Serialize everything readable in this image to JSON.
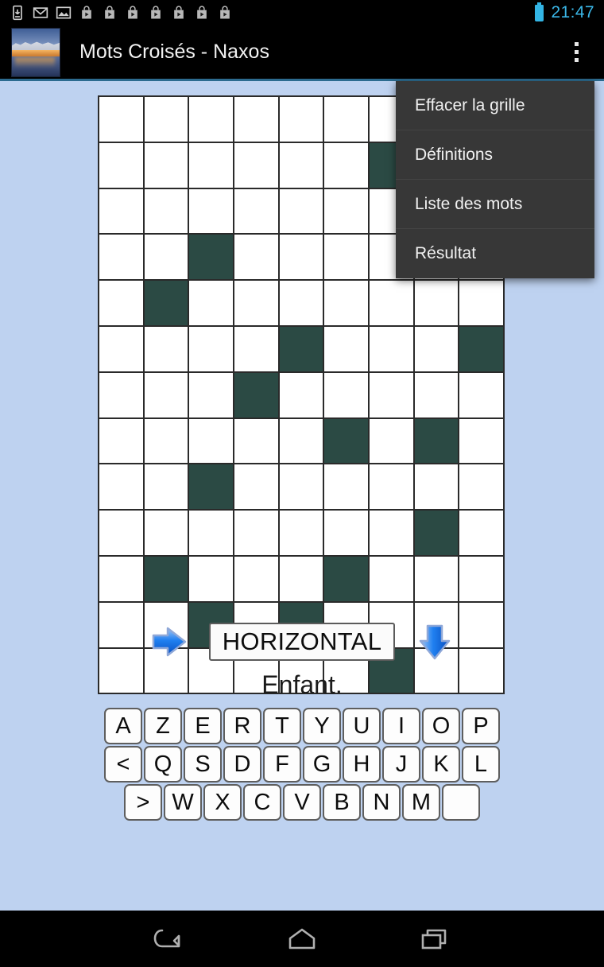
{
  "status_bar": {
    "clock": "21:47",
    "battery_icon": "battery-icon",
    "icons": [
      "download-icon",
      "gmail-icon",
      "screenshot-icon",
      "play-store-icon",
      "play-store-icon",
      "play-store-icon",
      "play-store-icon",
      "play-store-icon",
      "play-store-icon",
      "play-store-icon"
    ]
  },
  "action_bar": {
    "title": "Mots Croisés - Naxos",
    "app_icon": "naxos-photo-icon",
    "overflow_icon": "overflow-menu-icon"
  },
  "overflow_menu": {
    "items": [
      {
        "label": "Effacer la grille"
      },
      {
        "label": "Définitions"
      },
      {
        "label": "Liste des mots"
      },
      {
        "label": "Résultat"
      }
    ]
  },
  "grid": {
    "columns": 9,
    "rows": 13,
    "blocked_color": "#2b4a44",
    "cell_color": "#ffffff",
    "line_color": "#2a2a2a",
    "cells": [
      [
        "",
        "",
        "",
        "",
        "",
        "",
        "",
        "",
        ""
      ],
      [
        "",
        "",
        "",
        "",
        "",
        "",
        "#",
        "",
        ""
      ],
      [
        "",
        "",
        "",
        "",
        "",
        "",
        "",
        "",
        ""
      ],
      [
        "",
        "",
        "#",
        "",
        "",
        "",
        "",
        "",
        ""
      ],
      [
        "",
        "#",
        "",
        "",
        "",
        "",
        "",
        "",
        ""
      ],
      [
        "",
        "",
        "",
        "",
        "#",
        "",
        "",
        "",
        "#"
      ],
      [
        "",
        "",
        "",
        "#",
        "",
        "",
        "",
        "",
        ""
      ],
      [
        "",
        "",
        "",
        "",
        "",
        "#",
        "",
        "#",
        ""
      ],
      [
        "",
        "",
        "#",
        "",
        "",
        "",
        "",
        "",
        ""
      ],
      [
        "",
        "",
        "",
        "",
        "",
        "",
        "",
        "#",
        ""
      ],
      [
        "",
        "#",
        "",
        "",
        "",
        "#",
        "",
        "",
        ""
      ],
      [
        "",
        "",
        "#",
        "",
        "#",
        "",
        "",
        "",
        ""
      ],
      [
        "",
        "",
        "",
        "",
        "",
        "",
        "#",
        "",
        ""
      ]
    ]
  },
  "direction": {
    "prev_icon": "arrow-right-icon",
    "label": "HORIZONTAL",
    "next_icon": "arrow-down-icon"
  },
  "clue": {
    "text": "Enfant."
  },
  "keyboard": {
    "rows": [
      [
        "A",
        "Z",
        "E",
        "R",
        "T",
        "Y",
        "U",
        "I",
        "O",
        "P"
      ],
      [
        "<",
        "Q",
        "S",
        "D",
        "F",
        "G",
        "H",
        "J",
        "K",
        "L"
      ],
      [
        ">",
        "W",
        "X",
        "C",
        "V",
        "B",
        "N",
        "M",
        " "
      ]
    ]
  },
  "nav_bar": {
    "back_icon": "back-icon",
    "home_icon": "home-icon",
    "recents_icon": "recents-icon"
  },
  "colors": {
    "background": "#bed2f0",
    "grid_blocked": "#2b4a44",
    "accent_blue": "#33b5e5",
    "menu_background": "#373737"
  }
}
